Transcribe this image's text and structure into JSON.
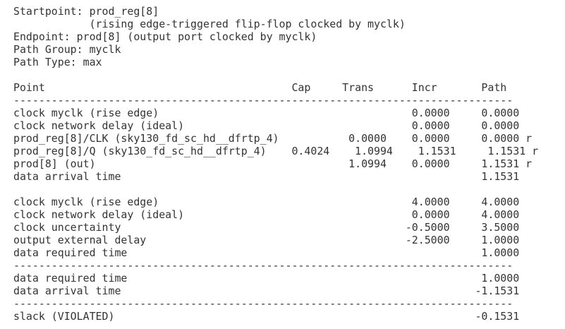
{
  "report": {
    "header": {
      "startpoint": "Startpoint: prod_reg[8]",
      "startpoint_detail": "            (rising edge-triggered flip-flop clocked by myclk)",
      "endpoint": "Endpoint: prod[8] (output port clocked by myclk)",
      "path_group": "Path Group: myclk",
      "path_type": "Path Type: max"
    },
    "table": {
      "column_header": "Point                                       Cap     Trans      Incr       Path",
      "separator": "-------------------------------------------------------------------------------",
      "arrival_rows": [
        "clock myclk (rise edge)                                        0.0000     0.0000",
        "clock network delay (ideal)                                    0.0000     0.0000",
        "prod_reg[8]/CLK (sky130_fd_sc_hd__dfrtp_4)           0.0000    0.0000     0.0000 r",
        "prod_reg[8]/Q (sky130_fd_sc_hd__dfrtp_4)    0.4024    1.0994    1.1531     1.1531 r",
        "prod[8] (out)                                        1.0994    0.0000     1.1531 r",
        "data arrival time                                                         1.1531"
      ],
      "required_rows": [
        "clock myclk (rise edge)                                        4.0000     4.0000",
        "clock network delay (ideal)                                    0.0000     4.0000",
        "clock uncertainty                                             -0.5000     3.5000",
        "output external delay                                         -2.5000     1.0000",
        "data required time                                                        1.0000"
      ],
      "summary_rows": [
        "data required time                                                        1.0000",
        "data arrival time                                                        -1.1531"
      ],
      "slack_row": "slack (VIOLATED)                                                         -0.1531"
    }
  }
}
